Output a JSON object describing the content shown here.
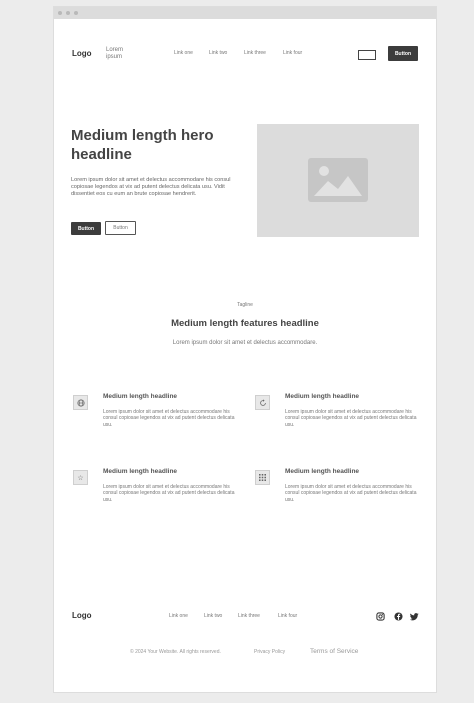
{
  "nav": {
    "logo": "Logo",
    "logo_sub": "Lorem ipsum",
    "links": [
      "Link one",
      "Link two",
      "Link three",
      "Link four"
    ],
    "button": "Button"
  },
  "hero": {
    "headline": "Medium length hero headline",
    "body": "Lorem ipsum dolor sit amet et delectus accommodare his consul copiosae legendos at vix ad putent delectus delicata usu. Vidit dissentiet eos cu eum an brute copiosae hendrerit.",
    "primary_button": "Button",
    "secondary_button": "Button"
  },
  "features": {
    "tagline": "Tagline",
    "headline": "Medium length features headline",
    "subtext": "Lorem ipsum dolor sit amet et delectus accommodare.",
    "items": [
      {
        "icon": "globe-icon",
        "title": "Medium length headline",
        "body": "Lorem ipsum dolor sit amet et delectus accommodare his consul copiosae legendos at vix ad putent delectus delicata usu."
      },
      {
        "icon": "refresh-icon",
        "title": "Medium length headline",
        "body": "Lorem ipsum dolor sit amet et delectus accommodare his consul copiosae legendos at vix ad putent delectus delicata usu."
      },
      {
        "icon": "star-icon",
        "title": "Medium length headline",
        "body": "Lorem ipsum dolor sit amet et delectus accommodare his consul copiosae legendos at vix ad putent delectus delicata usu."
      },
      {
        "icon": "grid-icon",
        "title": "Medium length headline",
        "body": "Lorem ipsum dolor sit amet et delectus accommodare his consul copiosae legendos at vix ad putent delectus delicata usu."
      }
    ]
  },
  "footer": {
    "logo": "Logo",
    "links": [
      "Link one",
      "Link two",
      "Link three",
      "Link four"
    ],
    "social_icons": [
      "instagram-icon",
      "facebook-icon",
      "twitter-icon"
    ],
    "copyright": "© 2024 Your Website. All rights reserved.",
    "privacy": "Privacy Policy",
    "terms": "Terms of Service"
  },
  "colors": {
    "page_background": "#ececec",
    "frame_background": "#ffffff",
    "placeholder_gray": "#dcdcdc",
    "dark_button": "#3c3c3c"
  }
}
